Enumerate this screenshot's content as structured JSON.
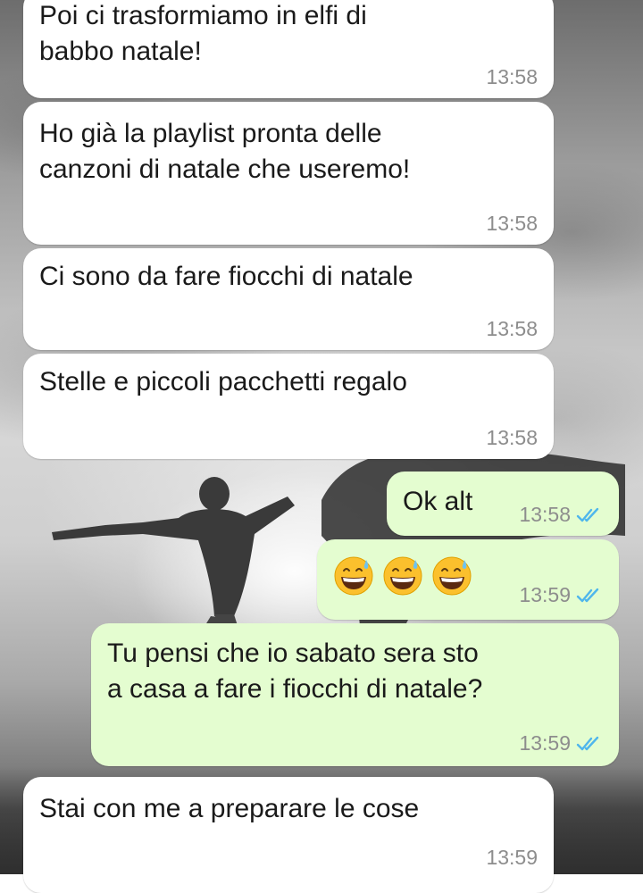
{
  "messages": [
    {
      "direction": "incoming",
      "text": "Poi ci trasformiamo in elfi di\nbabbo natale!",
      "time": "13:58"
    },
    {
      "direction": "incoming",
      "text": "Ho già la playlist pronta delle\ncanzoni di natale che useremo!",
      "time": "13:58"
    },
    {
      "direction": "incoming",
      "text": "Ci sono da fare fiocchi di natale",
      "time": "13:58"
    },
    {
      "direction": "incoming",
      "text": "Stelle e piccoli pacchetti regalo",
      "time": "13:58"
    },
    {
      "direction": "outgoing",
      "text": "Ok alt",
      "time": "13:58",
      "status": "read"
    },
    {
      "direction": "outgoing",
      "emoji": [
        "grinning-face-with-sweat",
        "grinning-face-with-sweat",
        "grinning-face-with-sweat"
      ],
      "time": "13:59",
      "status": "read"
    },
    {
      "direction": "outgoing",
      "text": "Tu pensi che io sabato sera sto\na casa a fare i fiocchi di natale?",
      "time": "13:59",
      "status": "read"
    },
    {
      "direction": "incoming",
      "text": "Stai con me a preparare le cose",
      "time": "13:59"
    }
  ],
  "colors": {
    "incoming_bubble": "#ffffff",
    "outgoing_bubble": "#e4fdd0",
    "read_ticks": "#4fb6ec",
    "timestamp": "#8d8d8d"
  },
  "icons": {
    "read_status": "double-check-icon",
    "emoji": "grinning-face-with-sweat-emoji"
  }
}
